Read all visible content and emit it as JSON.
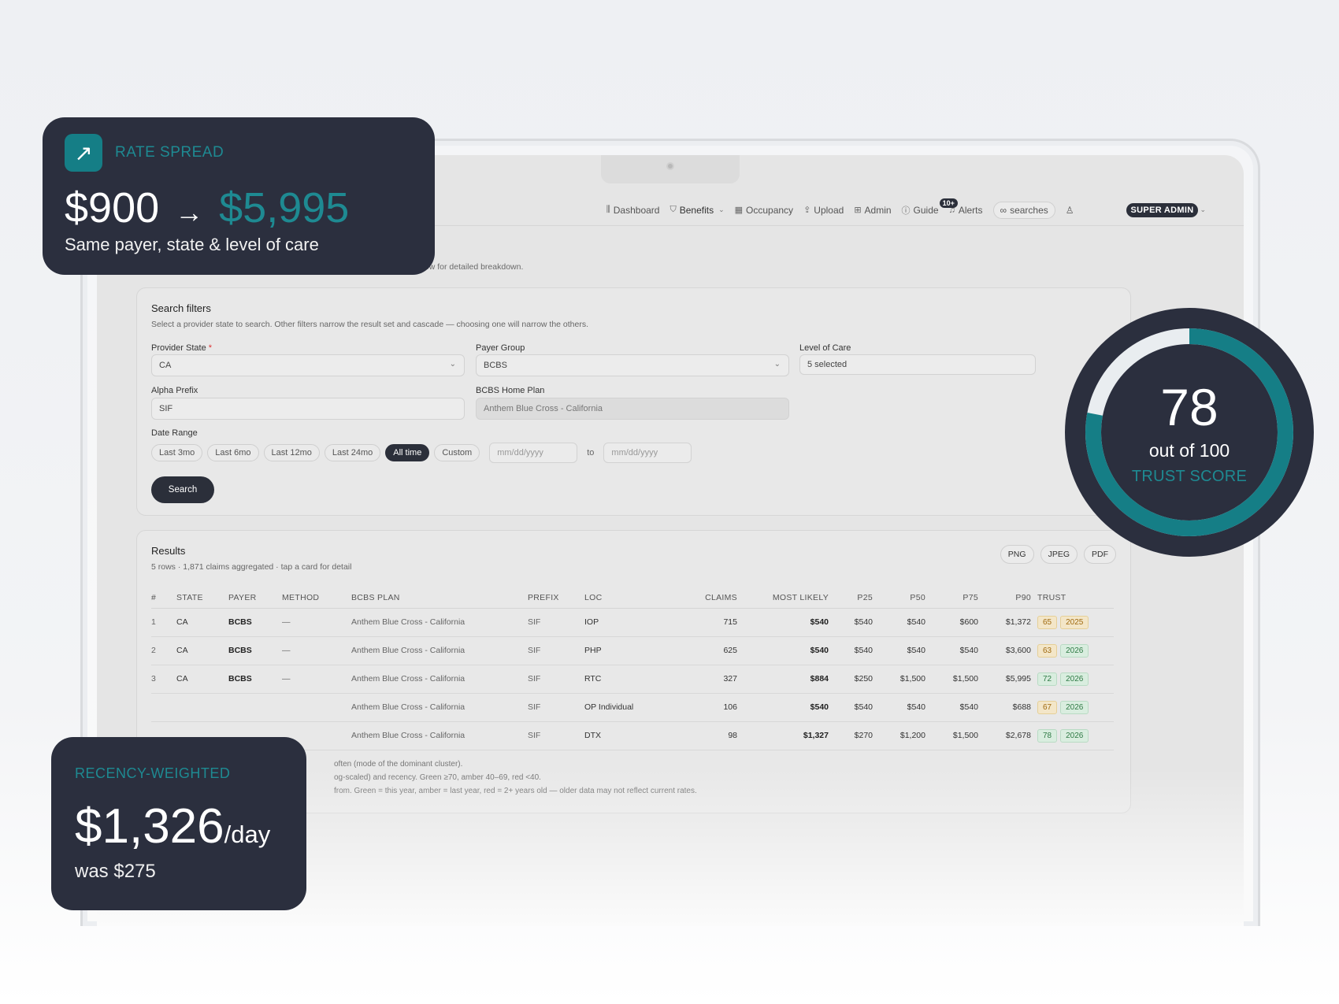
{
  "nav": {
    "items": [
      {
        "icon": "bar-chart-icon",
        "glyph": "⫼",
        "label": "Dashboard"
      },
      {
        "icon": "shield-icon",
        "glyph": "⛉",
        "label": "Benefits",
        "has_dropdown": true
      },
      {
        "icon": "calendar-icon",
        "glyph": "▦",
        "label": "Occupancy"
      },
      {
        "icon": "upload-icon",
        "glyph": "⇪",
        "label": "Upload"
      },
      {
        "icon": "grid-icon",
        "glyph": "⊞",
        "label": "Admin"
      },
      {
        "icon": "help-icon",
        "glyph": "ⓘ",
        "label": "Guide"
      }
    ],
    "alerts": {
      "label": "Alerts",
      "badge": "10+"
    },
    "searches": {
      "glyph": "∞",
      "label": "searches"
    },
    "role": "SUPER ADMIN"
  },
  "page": {
    "subtitle": "Search historical claims data for payer reimbursement benchmarks. Click any row for detailed breakdown."
  },
  "filters": {
    "title": "Search filters",
    "description": "Select a provider state to search. Other filters narrow the result set and cascade — choosing one will narrow the others.",
    "provider_state": {
      "label": "Provider State",
      "required_mark": "*",
      "value": "CA"
    },
    "payer_group": {
      "label": "Payer Group",
      "value": "BCBS"
    },
    "level_of_care": {
      "label": "Level of Care",
      "value": "5 selected"
    },
    "alpha_prefix": {
      "label": "Alpha Prefix",
      "value": "SIF"
    },
    "bcbs_home_plan": {
      "label": "BCBS Home Plan",
      "value": "Anthem Blue Cross - California"
    },
    "date_range": {
      "label": "Date Range",
      "chips": [
        "Last 3mo",
        "Last 6mo",
        "Last 12mo",
        "Last 24mo",
        "All time",
        "Custom"
      ],
      "active": "All time",
      "from_placeholder": "mm/dd/yyyy",
      "to_label": "to",
      "to_placeholder": "mm/dd/yyyy"
    },
    "search_label": "Search"
  },
  "results": {
    "title": "Results",
    "summary": "5 rows · 1,871 claims aggregated · tap a card for detail",
    "exports": [
      "PNG",
      "JPEG",
      "PDF"
    ],
    "columns": [
      "#",
      "STATE",
      "PAYER",
      "METHOD",
      "BCBS PLAN",
      "PREFIX",
      "LOC",
      "CLAIMS",
      "MOST LIKELY",
      "P25",
      "P50",
      "P75",
      "P90",
      "TRUST"
    ],
    "rows": [
      {
        "n": "1",
        "state": "CA",
        "payer": "BCBS",
        "method": "—",
        "plan": "Anthem Blue Cross - California",
        "prefix": "SIF",
        "loc": "IOP",
        "claims": "715",
        "most_likely": "$540",
        "p25": "$540",
        "p50": "$540",
        "p75": "$600",
        "p90": "$1,372",
        "trust": "65",
        "trust_color": "amber",
        "year": "2025",
        "year_color": "amber"
      },
      {
        "n": "2",
        "state": "CA",
        "payer": "BCBS",
        "method": "—",
        "plan": "Anthem Blue Cross - California",
        "prefix": "SIF",
        "loc": "PHP",
        "claims": "625",
        "most_likely": "$540",
        "p25": "$540",
        "p50": "$540",
        "p75": "$540",
        "p90": "$3,600",
        "trust": "63",
        "trust_color": "amber",
        "year": "2026",
        "year_color": "green"
      },
      {
        "n": "3",
        "state": "CA",
        "payer": "BCBS",
        "method": "—",
        "plan": "Anthem Blue Cross - California",
        "prefix": "SIF",
        "loc": "RTC",
        "claims": "327",
        "most_likely": "$884",
        "p25": "$250",
        "p50": "$1,500",
        "p75": "$1,500",
        "p90": "$5,995",
        "trust": "72",
        "trust_color": "green",
        "year": "2026",
        "year_color": "green"
      },
      {
        "n": "",
        "state": "",
        "payer": "",
        "method": "",
        "plan": "Anthem Blue Cross - California",
        "prefix": "SIF",
        "loc": "OP Individual",
        "claims": "106",
        "most_likely": "$540",
        "p25": "$540",
        "p50": "$540",
        "p75": "$540",
        "p90": "$688",
        "trust": "67",
        "trust_color": "amber",
        "year": "2026",
        "year_color": "green"
      },
      {
        "n": "",
        "state": "",
        "payer": "",
        "method": "",
        "plan": "Anthem Blue Cross - California",
        "prefix": "SIF",
        "loc": "DTX",
        "claims": "98",
        "most_likely": "$1,327",
        "p25": "$270",
        "p50": "$1,200",
        "p75": "$1,500",
        "p90": "$2,678",
        "trust": "78",
        "trust_color": "green",
        "year": "2026",
        "year_color": "green"
      }
    ],
    "footnotes": [
      "often (mode of the dominant cluster).",
      "og-scaled) and recency. Green ≥70, amber 40–69, red <40.",
      "from. Green = this year, amber = last year, red = 2+ years old — older data may not reflect current rates."
    ]
  },
  "rate_spread": {
    "icon": "arrow-up-right-icon",
    "label": "RATE SPREAD",
    "from": "$900",
    "arrow": "→",
    "to": "$5,995",
    "caption": "Same payer, state & level of care"
  },
  "trust_score": {
    "value": "78",
    "out_of": "out of 100",
    "label": "TRUST SCORE",
    "fraction": 0.78
  },
  "recency": {
    "label": "RECENCY-WEIGHTED",
    "value": "$1,326",
    "unit": "/day",
    "was": "was $275"
  },
  "colors": {
    "accent": "#1e8a92",
    "dark": "#2b2f3e",
    "amber": "#a06a10",
    "green": "#2f7a45"
  }
}
